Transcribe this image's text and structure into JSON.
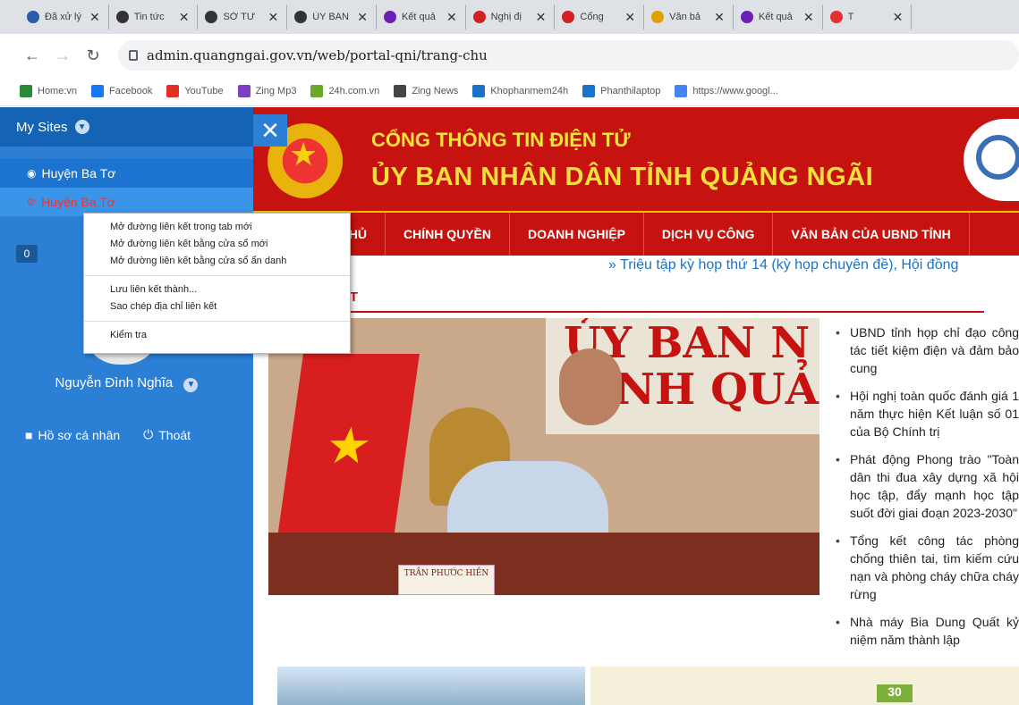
{
  "tabs": [
    {
      "title": "Đã xử lý",
      "fav_color": "#2a5ba8"
    },
    {
      "title": "Tin tức",
      "fav_color": "#333333"
    },
    {
      "title": "SỞ TƯ",
      "fav_color": "#333333"
    },
    {
      "title": "ỦY BAN",
      "fav_color": "#333333"
    },
    {
      "title": "Kết quả",
      "fav_color": "#6a1fb5"
    },
    {
      "title": "Nghị đị",
      "fav_color": "#d02020"
    },
    {
      "title": "Cổng",
      "fav_color": "#d02020"
    },
    {
      "title": "Văn bả",
      "fav_color": "#e0a000"
    },
    {
      "title": "Kết quả",
      "fav_color": "#6a1fb5"
    },
    {
      "title": "T",
      "fav_color": "#e33030"
    }
  ],
  "address": {
    "url": "admin.quangngai.gov.vn/web/portal-qni/trang-chu"
  },
  "bookmarks": [
    {
      "label": "Home:vn",
      "color": "#2a8a3a"
    },
    {
      "label": "Facebook",
      "color": "#1877f2"
    },
    {
      "label": "YouTube",
      "color": "#e52d27"
    },
    {
      "label": "Zing Mp3",
      "color": "#7b3fc2"
    },
    {
      "label": "24h.com.vn",
      "color": "#6aa82a"
    },
    {
      "label": "Zing News",
      "color": "#444444"
    },
    {
      "label": "Khophanmem24h",
      "color": "#1a73c9"
    },
    {
      "label": "Phanthilaptop",
      "color": "#1a73c9"
    },
    {
      "label": "https://www.googl...",
      "color": "#4285f4"
    }
  ],
  "sidebar": {
    "my_sites": "My Sites",
    "sites": [
      {
        "label": "Huyện Ba Tơ"
      },
      {
        "label": "Huyện Ba Tơ"
      }
    ],
    "badge": "0",
    "user_name": "Nguyễn Đình Nghĩa",
    "profile": "Hồ sơ cá nhân",
    "logout": "Thoát"
  },
  "context_menu": {
    "items_group1": [
      "Mở đường liên kết trong tab mới",
      "Mở đường liên kết bằng cửa sổ mới",
      "Mở đường liên kết bằng cửa sổ ẩn danh"
    ],
    "items_group2": [
      "Lưu liên kết thành...",
      "Sao chép địa chỉ liên kết"
    ],
    "items_group3": [
      "Kiểm tra"
    ]
  },
  "header": {
    "line1": "CỔNG THÔNG TIN ĐIỆN TỬ",
    "line2": "ỦY BAN NHÂN DÂN TỈNH QUẢNG NGÃI"
  },
  "nav": [
    "HỦ",
    "CHÍNH QUYỀN",
    "DOANH NGHIỆP",
    "DỊCH VỤ CÔNG",
    "VĂN BẢN CỦA UBND TỈNH"
  ],
  "ticker": "» Triệu tập kỳ họp thứ 14 (kỳ họp chuyên đề), Hội đồng",
  "section_title": "ẬT",
  "photo": {
    "wall_text": "ỦY BAN N\nTỈNH QUẢ",
    "nameplate": "TRẦN PHƯỚC HIỀN"
  },
  "news": [
    "UBND tỉnh họp chỉ đạo công tác tiết kiệm điện và đảm bảo cung",
    "Hội nghị toàn quốc đánh giá 1 năm thực hiện Kết luận số 01 của Bộ Chính trị",
    "Phát động Phong trào \"Toàn dân thi đua xây dựng xã hội học tập, đẩy mạnh học tập suốt đời giai đoạn 2023-2030\"",
    "Tổng kết công tác phòng chống thiên tai, tìm kiếm cứu nạn và phòng cháy chữa cháy rừng",
    "Nhà máy Bia Dung Quất kỷ niệm năm thành lập"
  ],
  "banner": {
    "number": "30"
  },
  "colors": {
    "sidebar": "#2b7fd4",
    "header_red": "#c6130f",
    "gold": "#f4e13b"
  }
}
